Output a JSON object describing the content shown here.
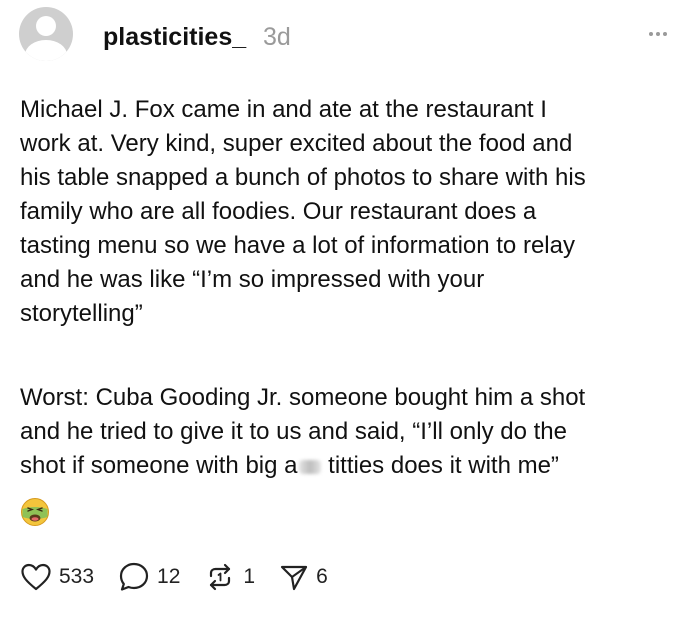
{
  "post": {
    "username": "plasticities_",
    "age": "3d",
    "body_p1": [
      "Michael J. Fox came in and ate at the restaurant I",
      "work at. Very kind, super excited about the food and",
      "his table snapped a bunch of photos to share with his",
      "family who are all foodies. Our restaurant does a",
      "tasting menu so we have a lot of information to relay",
      "and he was like “I’m so impressed with your",
      "storytelling”"
    ],
    "body_p2": [
      "Worst: Cuba Gooding Jr. someone bought him a shot",
      "and he tried to give it to us and said, “I’ll only do the"
    ],
    "body_p2_line3_before": "shot if someone with big a",
    "body_p2_line3_after": " titties does it with me”",
    "emoji": "nauseated-face",
    "actions": {
      "likes": "533",
      "replies": "12",
      "reposts": "1",
      "shares": "6"
    }
  },
  "icons": {
    "more": "more-dots-icon",
    "like": "heart-icon",
    "reply": "speech-bubble-icon",
    "repost": "repost-arrows-icon",
    "share": "paper-plane-icon"
  }
}
